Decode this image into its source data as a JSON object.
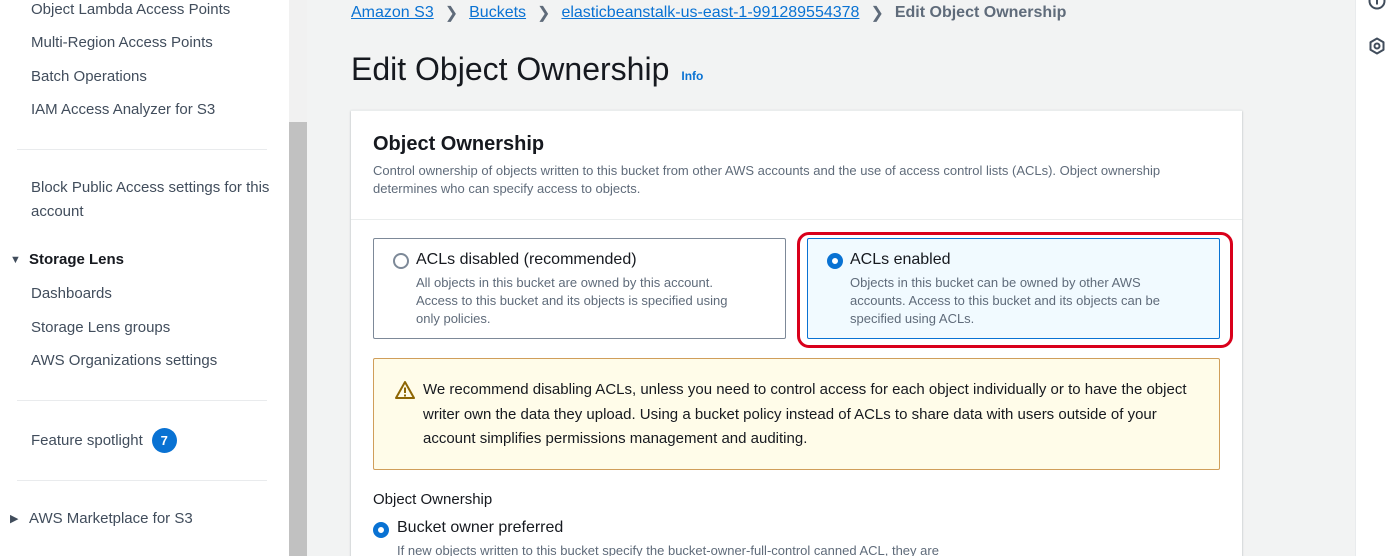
{
  "sidebar": {
    "items_top": [
      "Object Lambda Access Points",
      "Multi-Region Access Points",
      "Batch Operations",
      "IAM Access Analyzer for S3"
    ],
    "block_public_access": "Block Public Access settings for this account",
    "storage_lens": {
      "title": "Storage Lens",
      "items": [
        "Dashboards",
        "Storage Lens groups",
        "AWS Organizations settings"
      ]
    },
    "feature_spotlight": {
      "label": "Feature spotlight",
      "count": "7"
    },
    "marketplace": "AWS Marketplace for S3"
  },
  "breadcrumb": {
    "items": [
      "Amazon S3",
      "Buckets",
      "elasticbeanstalk-us-east-1-991289554378"
    ],
    "current": "Edit Object Ownership"
  },
  "page": {
    "title": "Edit Object Ownership",
    "info": "Info"
  },
  "panel": {
    "title": "Object Ownership",
    "description": "Control ownership of objects written to this bucket from other AWS accounts and the use of access control lists (ACLs). Object ownership determines who can specify access to objects.",
    "tiles": [
      {
        "label": "ACLs disabled (recommended)",
        "description": "All objects in this bucket are owned by this account. Access to this bucket and its objects is specified using only policies.",
        "selected": false
      },
      {
        "label": "ACLs enabled",
        "description": "Objects in this bucket can be owned by other AWS accounts. Access to this bucket and its objects can be specified using ACLs.",
        "selected": true
      }
    ],
    "warning": "We recommend disabling ACLs, unless you need to control access for each object individually or to have the object writer own the data they upload. Using a bucket policy instead of ACLs to share data with users outside of your account simplifies permissions management and auditing.",
    "ownership_label": "Object Ownership",
    "option": {
      "label": "Bucket owner preferred",
      "description": "If new objects written to this bucket specify the bucket-owner-full-control canned ACL, they are"
    }
  },
  "colors": {
    "link": "#0972d3",
    "highlight": "#d9001b",
    "warning_bg": "#fffce9",
    "warning_border": "#d09e5a"
  },
  "icons": {
    "rail_top": "info-circle-icon",
    "rail_second": "hexagon-gear-icon",
    "warning": "warning-triangle-icon"
  }
}
